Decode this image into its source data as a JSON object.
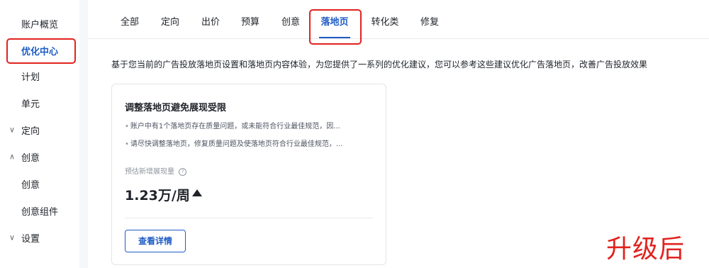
{
  "sidebar": {
    "items": [
      {
        "label": "账户概览",
        "chevron": ""
      },
      {
        "label": "优化中心",
        "chevron": "",
        "active": true
      },
      {
        "label": "计划",
        "chevron": ""
      },
      {
        "label": "单元",
        "chevron": ""
      },
      {
        "label": "定向",
        "chevron": "∨",
        "icon": "chevron-down-icon"
      },
      {
        "label": "创意",
        "chevron": "∧",
        "icon": "chevron-up-icon"
      },
      {
        "label": "创意",
        "chevron": ""
      },
      {
        "label": "创意组件",
        "chevron": ""
      },
      {
        "label": "设置",
        "chevron": "∨",
        "icon": "chevron-down-icon"
      }
    ]
  },
  "tabs": [
    {
      "label": "全部"
    },
    {
      "label": "定向"
    },
    {
      "label": "出价"
    },
    {
      "label": "预算"
    },
    {
      "label": "创意"
    },
    {
      "label": "落地页",
      "active": true
    },
    {
      "label": "转化类"
    },
    {
      "label": "修复"
    }
  ],
  "description": "基于您当前的广告投放落地页设置和落地页内容体验，为您提供了一系列的优化建议，您可以参考这些建议优化广告落地页，改善广告投放效果",
  "card": {
    "title": "调整落地页避免展现受限",
    "bullets": [
      "账户中有1个落地页存在质量问题，或未能符合行业最佳规范，因...",
      "请尽快调整落地页，修复质量问题及使落地页符合行业最佳规范，..."
    ],
    "estimate_label": "预估新增展现量",
    "help_icon": "question-circle-icon",
    "estimate_value": "1.23万/周",
    "trend_icon": "triangle-up-icon",
    "detail_button": "查看详情"
  },
  "annotation": {
    "text": "升级后",
    "color": "#e0231f"
  },
  "colors": {
    "accent": "#1f5cc5",
    "highlight": "#e0231f"
  }
}
